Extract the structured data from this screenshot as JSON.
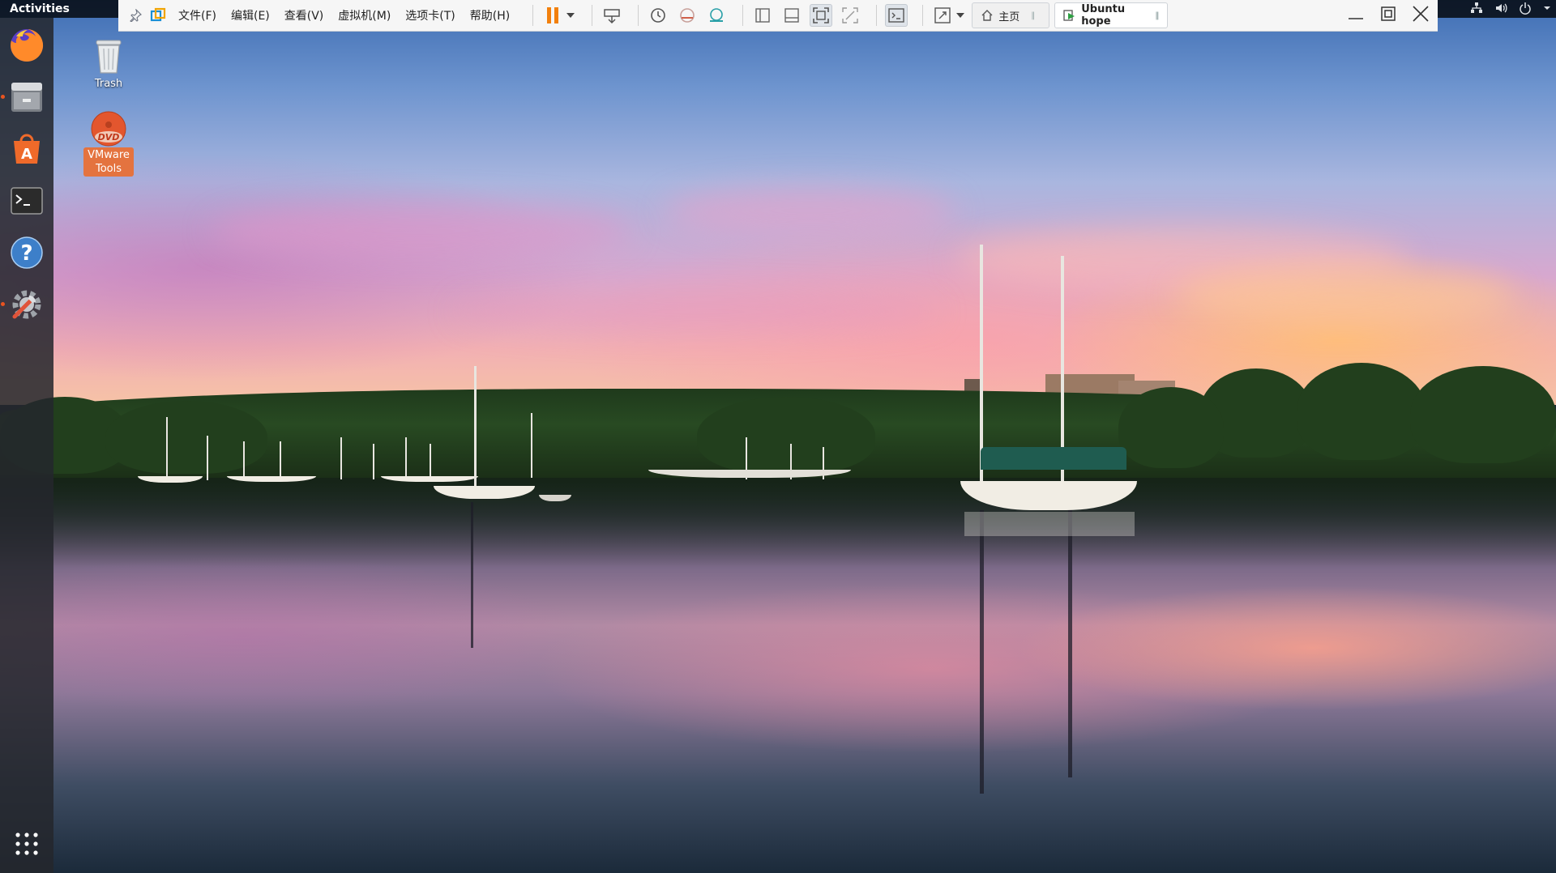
{
  "topbar": {
    "activities_label": "Activities",
    "tray_icons": [
      "network-icon",
      "volume-icon",
      "power-icon",
      "chevron-down-icon"
    ]
  },
  "vmware": {
    "menu": [
      "文件(F)",
      "编辑(E)",
      "查看(V)",
      "虚拟机(M)",
      "选项卡(T)",
      "帮助(H)"
    ],
    "toolbar_icons": [
      "pause-icon",
      "send-ctrl-alt-del-icon",
      "snapshot-take-icon",
      "snapshot-revert-icon",
      "snapshot-manager-icon",
      "library-icon",
      "thumbnail-bar-icon",
      "fullscreen-icon",
      "unity-icon",
      "console-icon",
      "stretch-icon"
    ],
    "tabs": [
      {
        "label": "主页",
        "icon": "home-icon"
      },
      {
        "label": "Ubuntu hope",
        "icon": "vm-running-icon"
      }
    ],
    "accent": "#f2800d"
  },
  "dock": {
    "items": [
      "firefox-icon",
      "files-icon",
      "software-center-icon",
      "terminal-icon",
      "help-icon",
      "settings-icon"
    ],
    "show_apps": "show-apps-icon",
    "running_color": "#e95420"
  },
  "desktop": {
    "icons": [
      {
        "label": "Trash",
        "icon": "trash-icon"
      },
      {
        "label": "VMware\nTools",
        "line1": "VMware",
        "line2": "Tools",
        "icon": "dvd-icon",
        "selected_color": "#e4733f"
      }
    ]
  }
}
